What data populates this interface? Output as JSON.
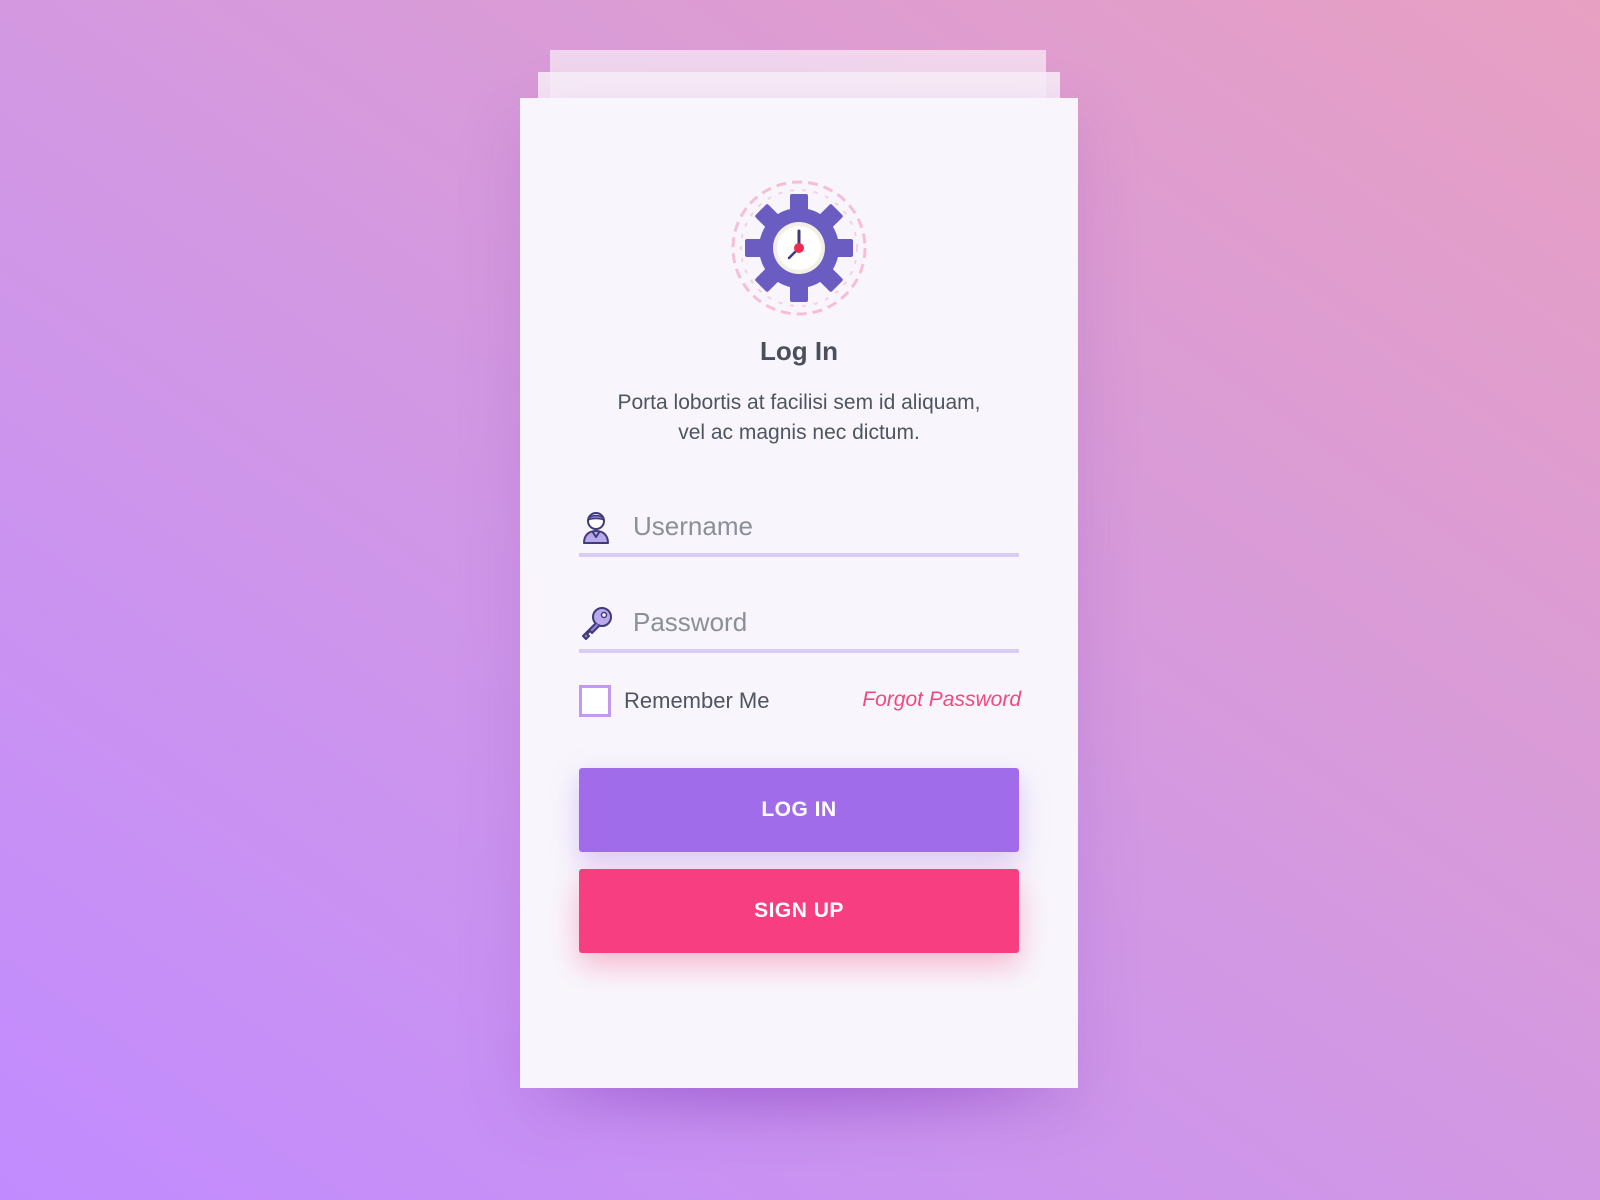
{
  "login_card": {
    "title": "Log In",
    "description_line1": "Porta lobortis at facilisi sem id aliquam,",
    "description_line2": "vel ac magnis nec dictum.",
    "logo_icon": "gear-clock-icon",
    "username": {
      "placeholder": "Username",
      "value": "",
      "icon": "user-icon"
    },
    "password": {
      "placeholder": "Password",
      "value": "",
      "icon": "key-icon"
    },
    "remember_me": {
      "label": "Remember Me",
      "checked": false
    },
    "forgot_password_label": "Forgot Password",
    "login_button_label": "LOG IN",
    "signup_button_label": "SIGN UP"
  },
  "colors": {
    "accent_purple": "#a06ce9",
    "accent_pink": "#f73e80",
    "gear_purple": "#6b5cc2",
    "link_pink": "#f2497d",
    "text_dark": "#4a4f5c"
  }
}
